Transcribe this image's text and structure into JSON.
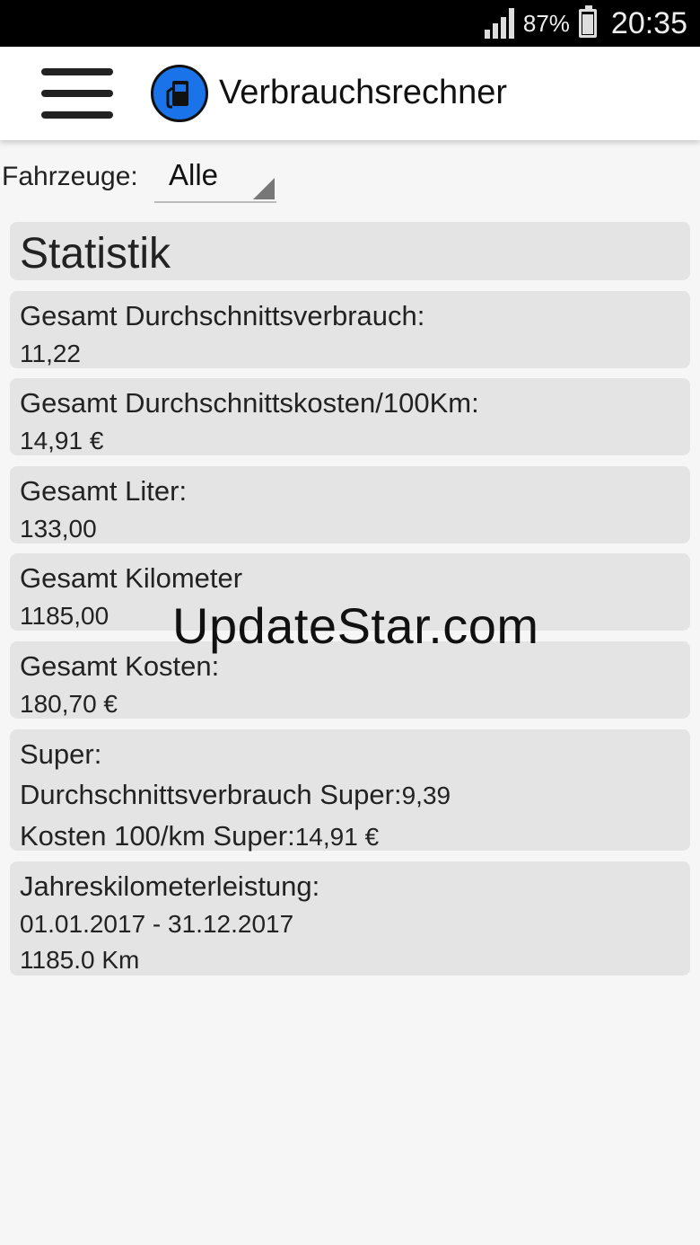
{
  "status_bar": {
    "battery_percent": "87%",
    "time": "20:35"
  },
  "app_bar": {
    "title": "Verbrauchsrechner",
    "menu_icon": "hamburger-menu-icon",
    "app_icon": "fuel-pump-icon",
    "accent_color": "#1a73e8"
  },
  "filter": {
    "label": "Fahrzeuge:",
    "selected": "Alle"
  },
  "statistik": {
    "heading": "Statistik",
    "avg_consumption": {
      "label": "Gesamt Durchschnittsverbrauch:",
      "value": "11,22"
    },
    "avg_cost": {
      "label": "Gesamt Durchschnittskosten/100Km:",
      "value": "14,91 €"
    },
    "liters": {
      "label": "Gesamt Liter:",
      "value": "133,00"
    },
    "kilometers": {
      "label": "Gesamt Kilometer",
      "value": "1185,00"
    },
    "costs": {
      "label": "Gesamt Kosten:",
      "value": "180,70 €"
    },
    "super": {
      "label": "Super:",
      "avg_label": "Durchschnittsverbrauch Super:",
      "avg_value": "9,39",
      "cost_label": "Kosten 100/km Super:",
      "cost_value": "14,91 €"
    },
    "yearly": {
      "label": "Jahreskilometerleistung:",
      "range": "01.01.2017 - 31.12.2017",
      "value": "1185.0 Km"
    }
  },
  "watermark": "UpdateStar.com"
}
